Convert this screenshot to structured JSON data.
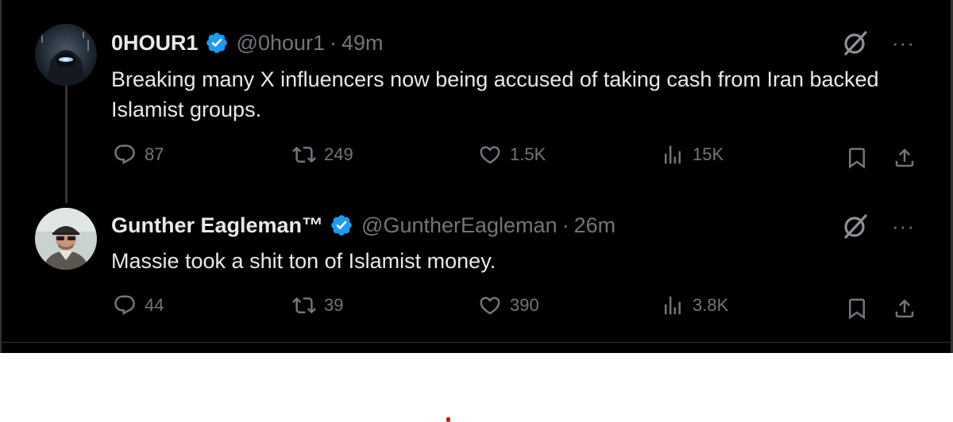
{
  "tweets": [
    {
      "display_name": "0HOUR1",
      "handle": "@0hour1",
      "separator": "·",
      "time": "49m",
      "text": "Breaking many X influencers now being accused of taking cash from Iran backed Islamist groups.",
      "replies": "87",
      "reposts": "249",
      "likes": "1.5K",
      "views": "15K",
      "verified": true
    },
    {
      "display_name": "Gunther Eagleman™",
      "handle": "@GuntherEagleman",
      "separator": "·",
      "time": "26m",
      "text": "Massie took a shit ton of Islamist money.",
      "replies": "44",
      "reposts": "39",
      "likes": "390",
      "views": "3.8K",
      "verified": true
    }
  ],
  "icons": {
    "more": "···",
    "verified": "verified-badge-icon",
    "grok": "grok-icon",
    "reply": "reply-icon",
    "repost": "repost-icon",
    "like": "like-icon",
    "views": "views-icon",
    "bookmark": "bookmark-icon",
    "share": "share-icon"
  },
  "colors": {
    "background": "#000000",
    "text": "#e7e9ea",
    "muted": "#71767b",
    "verified": "#1d9bf0"
  }
}
